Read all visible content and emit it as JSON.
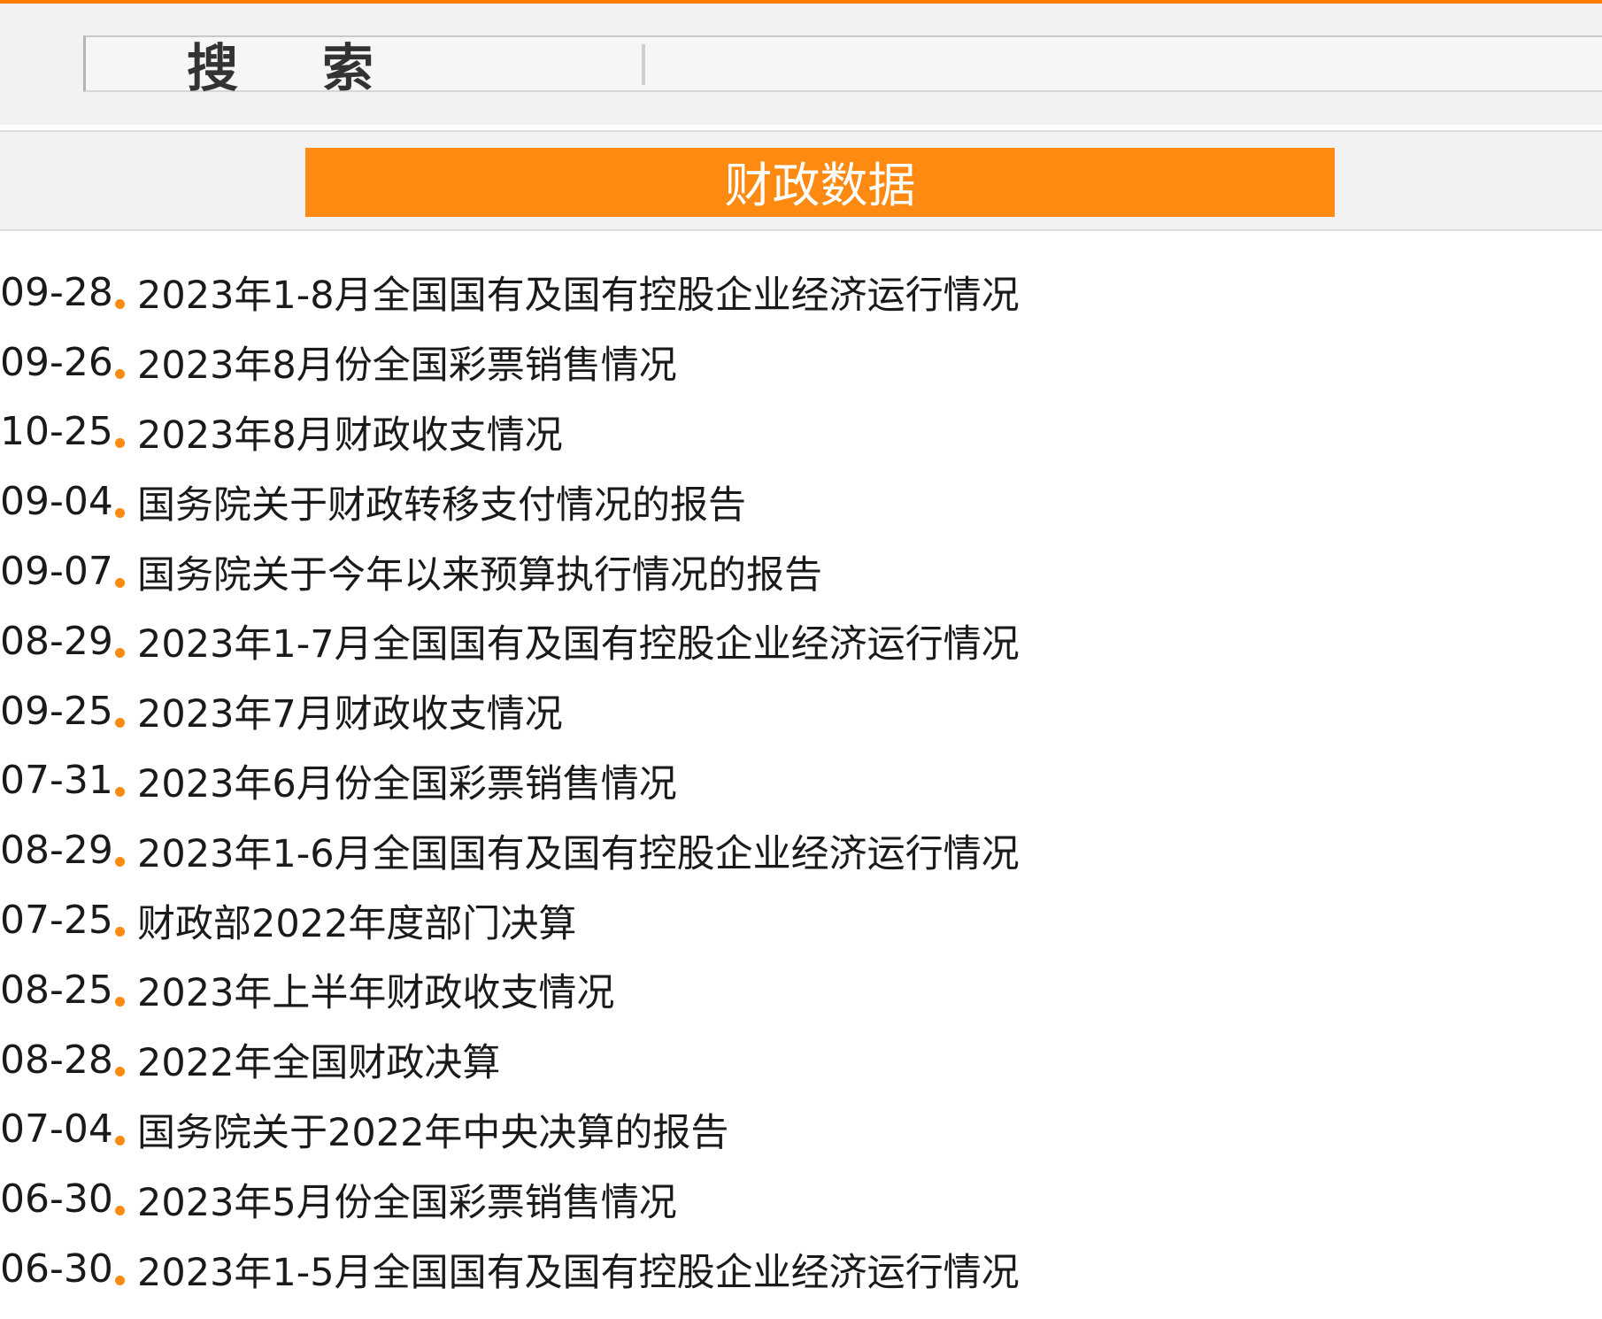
{
  "colors": {
    "accent": "#ff8a12",
    "top_bar": "#ff7a00",
    "band_background": "#f2f2f2",
    "text": "#1a1a1a"
  },
  "search": {
    "button_label": "搜索",
    "input_value": ""
  },
  "section": {
    "title": "财政数据"
  },
  "news": [
    {
      "date": "09-28",
      "title": "2023年1-8月全国国有及国有控股企业经济运行情况"
    },
    {
      "date": "09-26",
      "title": "2023年8月份全国彩票销售情况"
    },
    {
      "date": "10-25",
      "title": "2023年8月财政收支情况"
    },
    {
      "date": "09-04",
      "title": "国务院关于财政转移支付情况的报告"
    },
    {
      "date": "09-07",
      "title": "国务院关于今年以来预算执行情况的报告"
    },
    {
      "date": "08-29",
      "title": "2023年1-7月全国国有及国有控股企业经济运行情况"
    },
    {
      "date": "09-25",
      "title": "2023年7月财政收支情况"
    },
    {
      "date": "07-31",
      "title": "2023年6月份全国彩票销售情况"
    },
    {
      "date": "08-29",
      "title": "2023年1-6月全国国有及国有控股企业经济运行情况"
    },
    {
      "date": "07-25",
      "title": "财政部2022年度部门决算"
    },
    {
      "date": "08-25",
      "title": "2023年上半年财政收支情况"
    },
    {
      "date": "08-28",
      "title": "2022年全国财政决算"
    },
    {
      "date": "07-04",
      "title": "国务院关于2022年中央决算的报告"
    },
    {
      "date": "06-30",
      "title": "2023年5月份全国彩票销售情况"
    },
    {
      "date": "06-30",
      "title": "2023年1-5月全国国有及国有控股企业经济运行情况"
    }
  ]
}
